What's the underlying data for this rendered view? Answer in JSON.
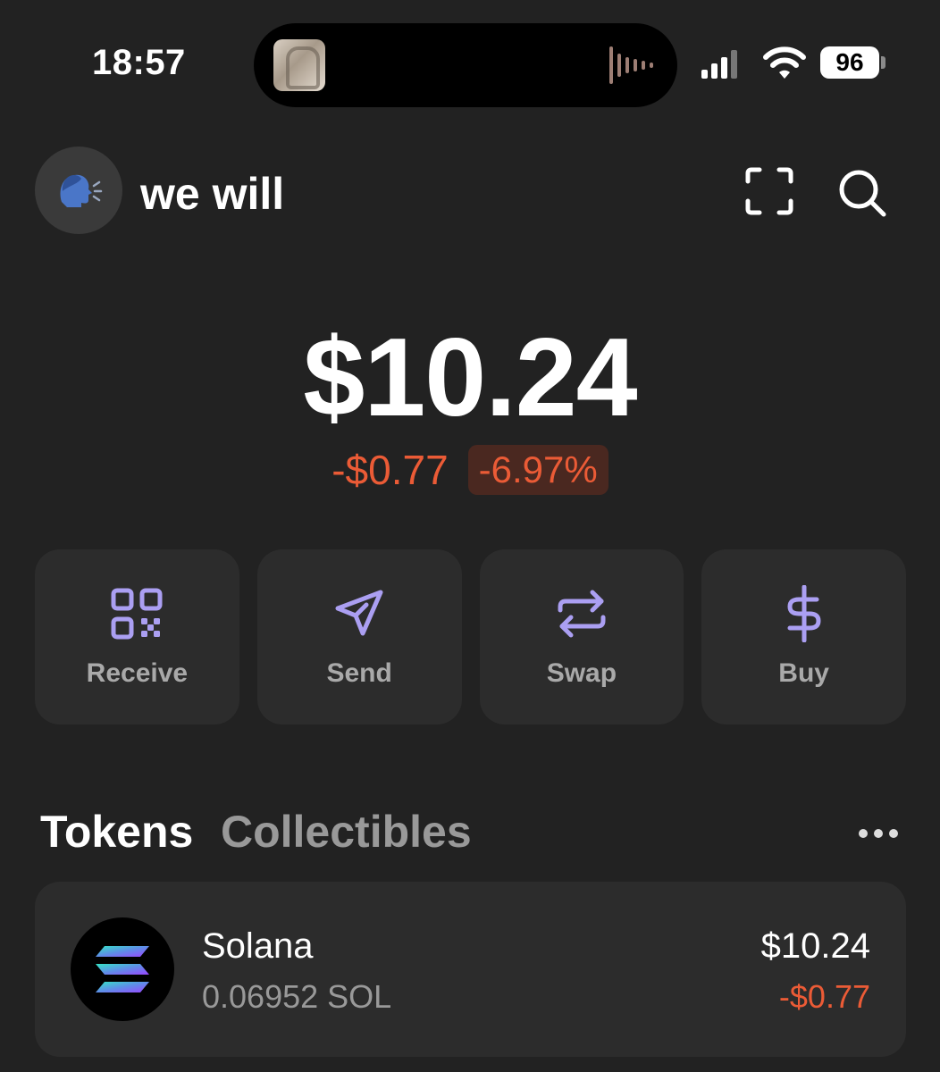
{
  "status_bar": {
    "time": "18:57",
    "battery": "96"
  },
  "header": {
    "account_name": "we will",
    "avatar_icon": "speaking-head-icon",
    "scan_icon": "scan-frame-icon",
    "search_icon": "search-icon"
  },
  "balance": {
    "total": "$10.24",
    "change_amount": "-$0.77",
    "change_percent": "-6.97%"
  },
  "actions": [
    {
      "label": "Receive",
      "icon": "qr-code-icon"
    },
    {
      "label": "Send",
      "icon": "send-icon"
    },
    {
      "label": "Swap",
      "icon": "swap-icon"
    },
    {
      "label": "Buy",
      "icon": "dollar-icon"
    }
  ],
  "tabs": {
    "tokens": "Tokens",
    "collectibles": "Collectibles"
  },
  "tokens": [
    {
      "name": "Solana",
      "amount": "0.06952 SOL",
      "value": "$10.24",
      "change": "-$0.77",
      "icon": "solana-logo-icon"
    }
  ],
  "colors": {
    "background": "#222222",
    "card": "#2c2c2c",
    "accent": "#ab9ff2",
    "negative": "#eb5b36"
  }
}
